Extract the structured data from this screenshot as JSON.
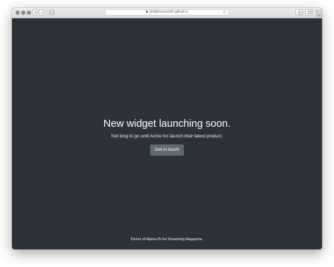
{
  "browser": {
    "url": "philipboyesmith.github.io",
    "colors": {
      "page_background": "#2d3239",
      "button_background": "#616971"
    }
  },
  "hero": {
    "headline": "New widget launching soon.",
    "subline": "Not long to go until Acme Inc launch their latest product.",
    "cta_label": "Get in touch"
  },
  "footer": {
    "text": "Demo of AlpineJS for Smashing Magazine."
  }
}
